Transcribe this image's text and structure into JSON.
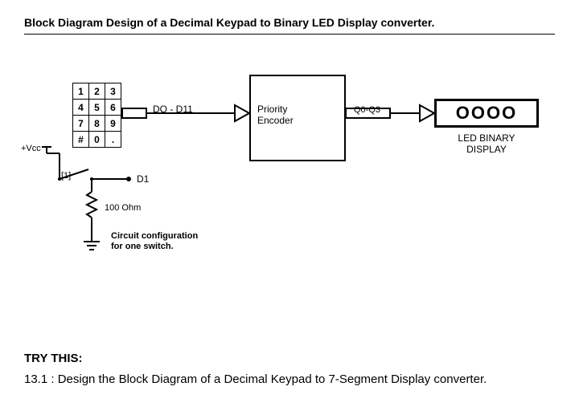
{
  "title": "Block Diagram Design of a Decimal Keypad to Binary LED Display converter.",
  "keypad": {
    "rows": [
      [
        "1",
        "2",
        "3"
      ],
      [
        "4",
        "5",
        "6"
      ],
      [
        "7",
        "8",
        "9"
      ],
      [
        "#",
        "0",
        "."
      ]
    ]
  },
  "vcc_label": "+Vcc",
  "switch_ref": "[1]",
  "arrow1_label": "DO - D11",
  "encoder_label": "Priority\nEncoder",
  "arrow2_label": "Q0-Q3",
  "led_glyph": "OOOO",
  "led_caption": "LED BINARY\nDISPLAY",
  "d1_label": "D1",
  "resistor_label": "100 Ohm",
  "circuit_caption": "Circuit configuration\nfor one switch.",
  "trythis": "TRY THIS:",
  "task": "13.1 : Design  the Block Diagram of a Decimal Keypad to 7-Segment Display converter."
}
